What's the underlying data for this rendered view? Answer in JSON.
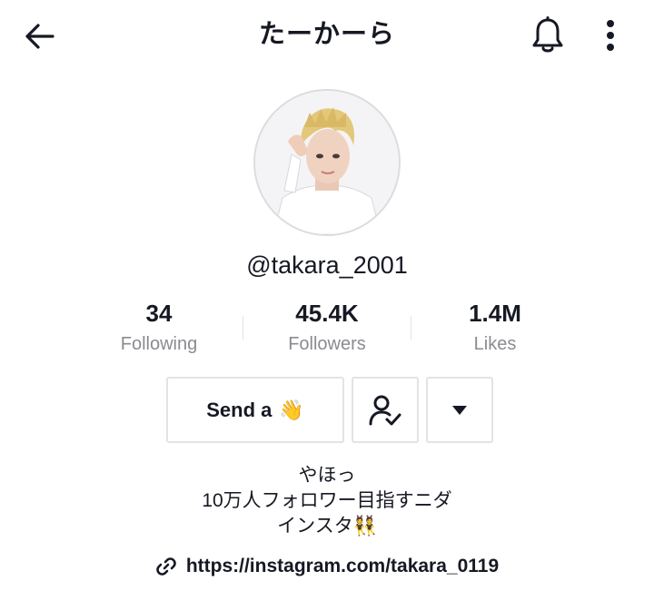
{
  "header": {
    "title": "たーかーら"
  },
  "profile": {
    "username": "@takara_2001"
  },
  "stats": [
    {
      "value": "34",
      "label": "Following"
    },
    {
      "value": "45.4K",
      "label": "Followers"
    },
    {
      "value": "1.4M",
      "label": "Likes"
    }
  ],
  "actions": {
    "send_label": "Send a",
    "send_emoji": "👋"
  },
  "bio": {
    "lines": [
      "やほっ",
      "10万人フォロワー目指すニダ",
      "インスタ👯"
    ]
  },
  "link": {
    "url": "https://instagram.com/takara_0119"
  },
  "colors": {
    "text": "#161823",
    "muted": "#8a8b91",
    "border": "#e3e3e4"
  }
}
